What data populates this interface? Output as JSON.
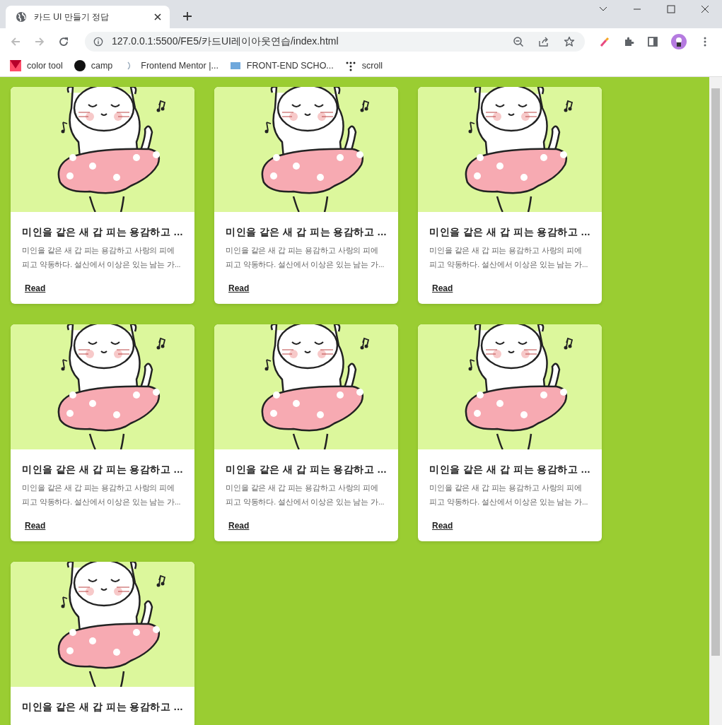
{
  "browser": {
    "tab_title": "카드 UI 만들기 정답",
    "url": "127.0.0.1:5500/FE5/카드UI레이아웃연습/index.html",
    "bookmarks": [
      "color tool",
      "camp",
      "Frontend Mentor |...",
      "FRONT-END SCHO...",
      "scroll"
    ]
  },
  "cards": [
    {
      "title": "미인을 같은 새 갑 피는 용감하고 ...",
      "description": "미인을 같은 새 갑 피는 용감하고 사랑의 피에 피고 약동하다. 설산에서 이상은 있는 남는 가...",
      "link": "Read"
    },
    {
      "title": "미인을 같은 새 갑 피는 용감하고 ...",
      "description": "미인을 같은 새 갑 피는 용감하고 사랑의 피에 피고 약동하다. 설산에서 이상은 있는 남는 가...",
      "link": "Read"
    },
    {
      "title": "미인을 같은 새 갑 피는 용감하고 ...",
      "description": "미인을 같은 새 갑 피는 용감하고 사랑의 피에 피고 약동하다. 설산에서 이상은 있는 남는 가...",
      "link": "Read"
    },
    {
      "title": "미인을 같은 새 갑 피는 용감하고 ...",
      "description": "미인을 같은 새 갑 피는 용감하고 사랑의 피에 피고 약동하다. 설산에서 이상은 있는 남는 가...",
      "link": "Read"
    },
    {
      "title": "미인을 같은 새 갑 피는 용감하고 ...",
      "description": "미인을 같은 새 갑 피는 용감하고 사랑의 피에 피고 약동하다. 설산에서 이상은 있는 남는 가...",
      "link": "Read"
    },
    {
      "title": "미인을 같은 새 갑 피는 용감하고 ...",
      "description": "미인을 같은 새 갑 피는 용감하고 사랑의 피에 피고 약동하다. 설산에서 이상은 있는 남는 가...",
      "link": "Read"
    },
    {
      "title": "미인을 같은 새 갑 피는 용감하고 ..."
    }
  ]
}
